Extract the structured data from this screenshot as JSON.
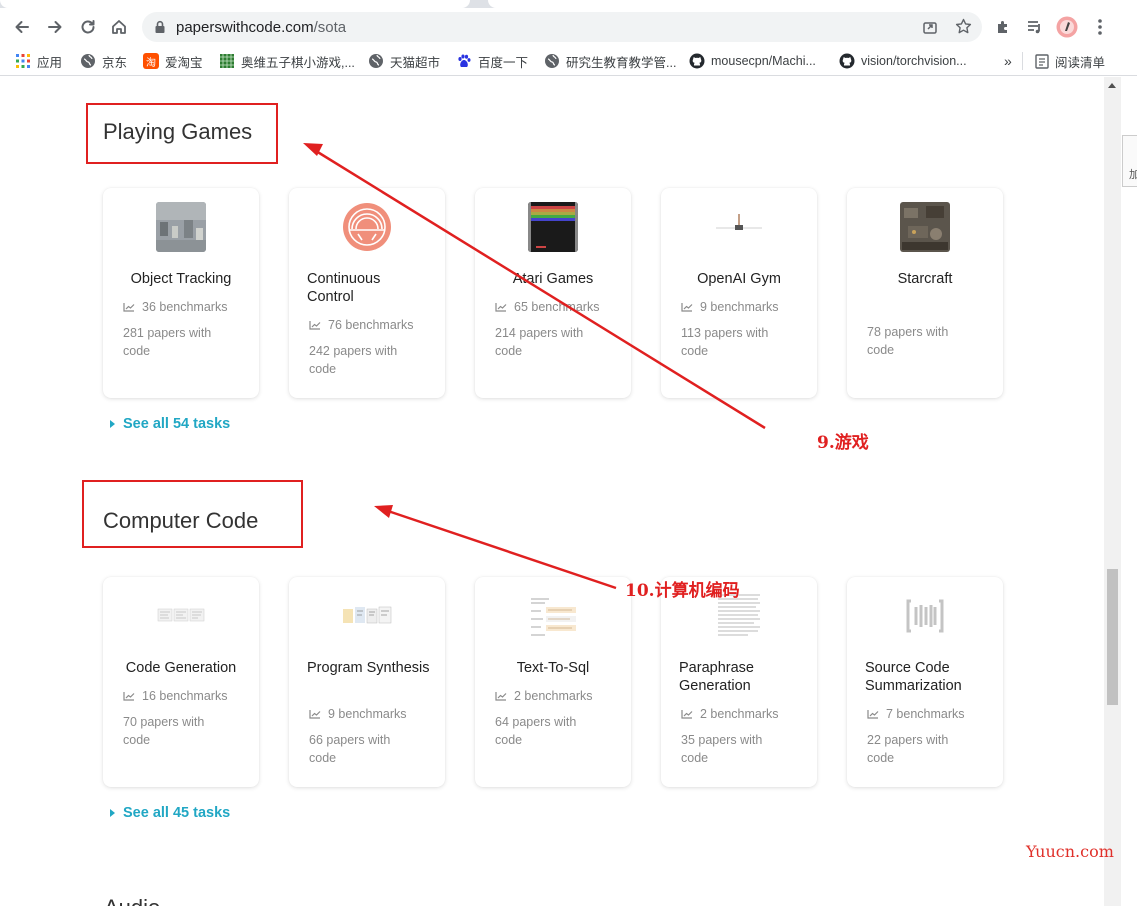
{
  "browser": {
    "url_host": "paperswithcode.com",
    "url_path": "/sota",
    "bookmarks": [
      {
        "label": "应用",
        "icon": "apps-grid-icon",
        "color": "#4285f4"
      },
      {
        "label": "京东",
        "icon": "globe-icon",
        "color": "#5f6368"
      },
      {
        "label": "爱淘宝",
        "icon": "taobao-icon",
        "color": "#ff5000"
      },
      {
        "label": "奥维五子棋小游戏,...",
        "icon": "game-icon",
        "color": "#2e7d32"
      },
      {
        "label": "天猫超市",
        "icon": "globe-icon",
        "color": "#5f6368"
      },
      {
        "label": "百度一下",
        "icon": "baidu-paw-icon",
        "color": "#2932e1"
      },
      {
        "label": "研究生教育教学管...",
        "icon": "globe-icon",
        "color": "#5f6368"
      },
      {
        "label": "mousecpn/Machi...",
        "icon": "github-icon",
        "color": "#24292e"
      },
      {
        "label": "vision/torchvision...",
        "icon": "github-icon",
        "color": "#24292e"
      }
    ],
    "overflow_label": "»",
    "reading_list_label": "阅读清单"
  },
  "sections": [
    {
      "title": "Playing Games",
      "see_all": "See all 54 tasks",
      "cards": [
        {
          "title": "Object Tracking",
          "benchmarks": "36 benchmarks",
          "papers": "281 papers with code",
          "thumb": "object-tracking-thumb"
        },
        {
          "title": "Continuous Control",
          "benchmarks": "76 benchmarks",
          "papers": "242 papers with code",
          "thumb": "continuous-control-thumb"
        },
        {
          "title": "Atari Games",
          "benchmarks": "65 benchmarks",
          "papers": "214 papers with code",
          "thumb": "atari-games-thumb"
        },
        {
          "title": "OpenAI Gym",
          "benchmarks": "9 benchmarks",
          "papers": "113 papers with code",
          "thumb": "openai-gym-thumb"
        },
        {
          "title": "Starcraft",
          "benchmarks": "",
          "papers": "78 papers with code",
          "thumb": "starcraft-thumb"
        }
      ]
    },
    {
      "title": "Computer Code",
      "see_all": "See all 45 tasks",
      "cards": [
        {
          "title": "Code Generation",
          "benchmarks": "16 benchmarks",
          "papers": "70 papers with code",
          "thumb": "code-generation-thumb"
        },
        {
          "title": "Program Synthesis",
          "benchmarks": "9 benchmarks",
          "papers": "66 papers with code",
          "thumb": "program-synthesis-thumb"
        },
        {
          "title": "Text-To-Sql",
          "benchmarks": "2 benchmarks",
          "papers": "64 papers with code",
          "thumb": "text-to-sql-thumb"
        },
        {
          "title": "Paraphrase Generation",
          "benchmarks": "2 benchmarks",
          "papers": "35 papers with code",
          "thumb": "paraphrase-generation-thumb"
        },
        {
          "title": "Source Code Summarization",
          "benchmarks": "7 benchmarks",
          "papers": "22 papers with code",
          "thumb": "source-code-summarization-thumb"
        }
      ]
    }
  ],
  "next_section_partial": "Audio",
  "annotations": {
    "games": "9.游戏",
    "code": "10.计算机编码",
    "color": "#e02020"
  },
  "watermark": "Yuucn.com",
  "side_fragment": "加"
}
